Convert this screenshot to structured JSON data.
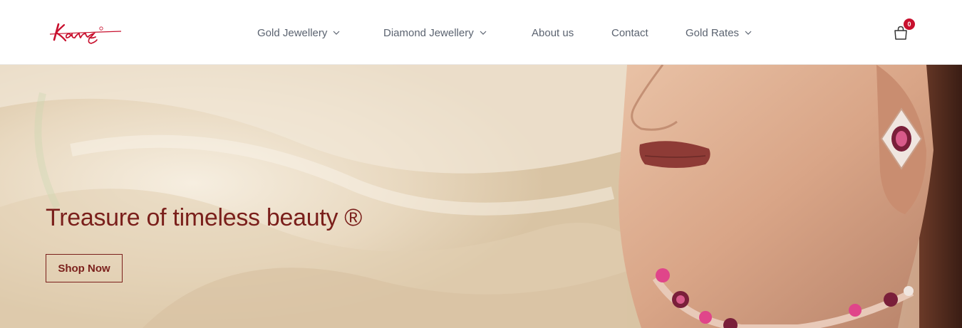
{
  "brand": {
    "logo_text": "Kanz",
    "accent": "#c8102e"
  },
  "nav": {
    "items": [
      {
        "label": "Gold Jewellery",
        "has_dropdown": true
      },
      {
        "label": "Diamond Jewellery",
        "has_dropdown": true
      },
      {
        "label": "About us",
        "has_dropdown": false
      },
      {
        "label": "Contact",
        "has_dropdown": false
      },
      {
        "label": "Gold Rates",
        "has_dropdown": true
      }
    ],
    "text_color": "#5b6370"
  },
  "cart": {
    "icon": "shopping-bag-icon",
    "count": "0"
  },
  "hero": {
    "title": "Treasure of timeless beauty ®",
    "cta_label": "Shop Now",
    "text_color": "#7a1f1b"
  }
}
